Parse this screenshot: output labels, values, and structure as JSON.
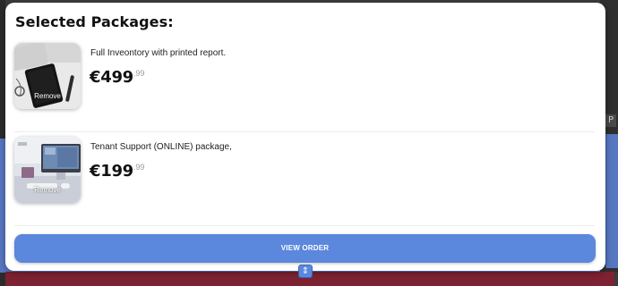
{
  "modal": {
    "title": "Selected Packages:",
    "view_order_label": "VIEW ORDER"
  },
  "packages": [
    {
      "name": "Full Inveontory with printed report.",
      "price_main": "€499",
      "price_cents": ".99",
      "remove_label": "Remove",
      "thumbnail": "tablet-on-desk-image"
    },
    {
      "name": "Tenant Support (ONLINE) package,",
      "price_main": "€199",
      "price_cents": ".99",
      "remove_label": "Remove",
      "thumbnail": "imac-desk-image"
    }
  ],
  "backdrop": {
    "side_label": "P",
    "resize_icon": "resize-vertical-icon"
  },
  "colors": {
    "accent": "#5b87dc",
    "backdrop_blue": "#5877c2",
    "backdrop_dark": "#7d2232"
  }
}
